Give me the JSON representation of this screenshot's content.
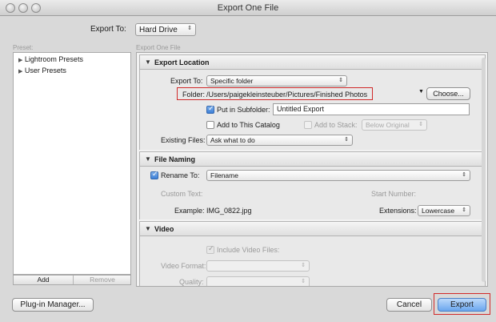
{
  "window": {
    "title": "Export One File"
  },
  "header": {
    "export_to_label": "Export To:",
    "export_to_value": "Hard Drive"
  },
  "preset": {
    "label": "Preset:",
    "items": [
      "Lightroom Presets",
      "User Presets"
    ],
    "add_label": "Add",
    "remove_label": "Remove"
  },
  "subtitle": "Export One File",
  "export_location": {
    "title": "Export Location",
    "export_to_label": "Export To:",
    "export_to_value": "Specific folder",
    "folder_label": "Folder:",
    "folder_path": "/Users/paigekleinsteuber/Pictures/Finished Photos",
    "choose_label": "Choose...",
    "put_in_subfolder_label": "Put in Subfolder:",
    "subfolder_value": "Untitled Export",
    "add_to_catalog_label": "Add to This Catalog",
    "add_to_stack_label": "Add to Stack:",
    "stack_value": "Below Original",
    "existing_files_label": "Existing Files:",
    "existing_files_value": "Ask what to do"
  },
  "file_naming": {
    "title": "File Naming",
    "rename_to_label": "Rename To:",
    "rename_to_value": "Filename",
    "custom_text_label": "Custom Text:",
    "start_number_label": "Start Number:",
    "example_label": "Example:",
    "example_value": "IMG_0822.jpg",
    "extensions_label": "Extensions:",
    "extensions_value": "Lowercase"
  },
  "video": {
    "title": "Video",
    "include_label": "Include Video Files:",
    "format_label": "Video Format:",
    "quality_label": "Quality:"
  },
  "footer": {
    "plugin_manager_label": "Plug-in Manager...",
    "cancel_label": "Cancel",
    "export_label": "Export"
  },
  "colors": {
    "highlight": "#d12a2a",
    "default_button": "#6aa6ee"
  }
}
